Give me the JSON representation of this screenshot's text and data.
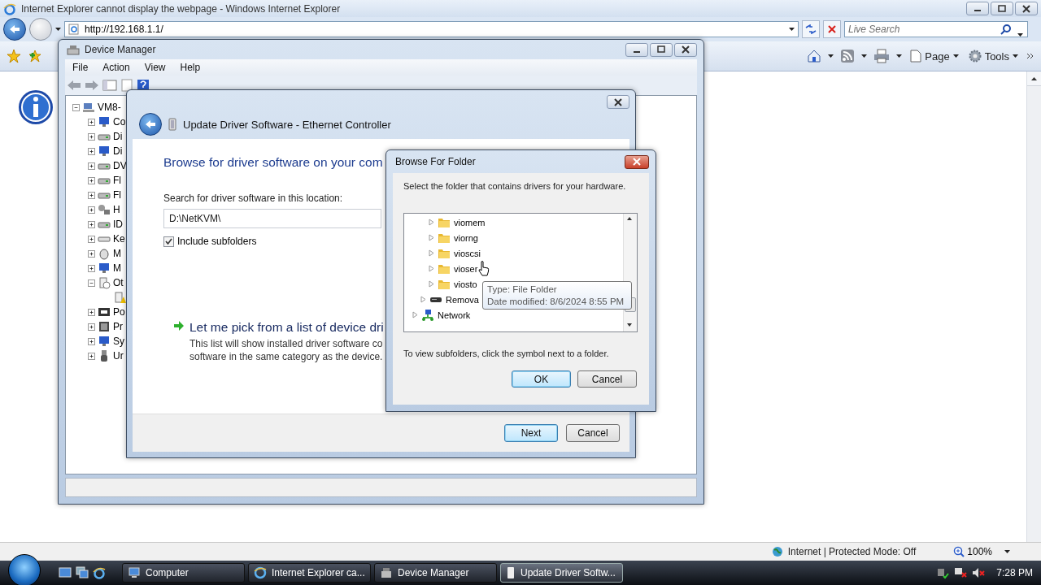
{
  "browser": {
    "title": "Internet Explorer cannot display the webpage - Windows Internet Explorer",
    "address": "http://192.168.1.1/",
    "search": {
      "placeholder": "Live Search"
    },
    "commands": [
      {
        "label": "Page",
        "kind": "page"
      },
      {
        "label": "Tools",
        "kind": "tools"
      }
    ],
    "status": "Internet | Protected Mode: Off",
    "zoom": "100%"
  },
  "device_manager": {
    "title": "Device Manager",
    "menu": [
      "File",
      "Action",
      "View",
      "Help"
    ],
    "tree": {
      "label": "VM8-",
      "expanded": true,
      "kind": "computer",
      "children": [
        {
          "label": "Co",
          "expanded": false,
          "kind": "monitor"
        },
        {
          "label": "Di",
          "expanded": false,
          "kind": "drive"
        },
        {
          "label": "Di",
          "expanded": false,
          "kind": "monitor"
        },
        {
          "label": "DV",
          "expanded": false,
          "kind": "drive"
        },
        {
          "label": "Fl",
          "expanded": false,
          "kind": "drive"
        },
        {
          "label": "Fl",
          "expanded": false,
          "kind": "drive"
        },
        {
          "label": "H",
          "expanded": false,
          "kind": "hid"
        },
        {
          "label": "ID",
          "expanded": false,
          "kind": "drive"
        },
        {
          "label": "Ke",
          "expanded": false,
          "kind": "keyboard"
        },
        {
          "label": "M",
          "expanded": false,
          "kind": "mouse"
        },
        {
          "label": "M",
          "expanded": false,
          "kind": "monitor"
        },
        {
          "label": "Ot",
          "expanded": true,
          "kind": "unknown",
          "children": [
            {
              "kind": "warning"
            }
          ]
        },
        {
          "label": "Po",
          "expanded": false,
          "kind": "port"
        },
        {
          "label": "Pr",
          "expanded": false,
          "kind": "chip"
        },
        {
          "label": "Sy",
          "expanded": false,
          "kind": "monitor"
        },
        {
          "label": "Ur",
          "expanded": false,
          "kind": "usb"
        }
      ]
    }
  },
  "update_driver": {
    "title": "Update Driver Software - Ethernet Controller",
    "heading": "Browse for driver software on your com",
    "location_label": "Search for driver software in this location:",
    "location": "D:\\NetKVM\\",
    "include_subfolders": {
      "label": "Include subfolders",
      "checked": true
    },
    "option": {
      "title": "Let me pick from a list of device dri",
      "description": [
        "This list will show installed driver software co",
        "software in the same category as the device."
      ]
    },
    "buttons": [
      {
        "label": "Next",
        "default": true
      },
      {
        "label": "Cancel",
        "default": false
      }
    ]
  },
  "browse_folder": {
    "title": "Browse For Folder",
    "instruction": "Select the folder that contains drivers for your hardware.",
    "tree": [
      {
        "children": [
          {
            "children": [
              {
                "label": "viomem",
                "kind": "folder"
              },
              {
                "label": "viorng",
                "kind": "folder"
              },
              {
                "label": "vioscsi",
                "kind": "folder"
              },
              {
                "label": "vioser",
                "kind": "folder"
              },
              {
                "label": "viosto",
                "kind": "folder"
              }
            ]
          },
          {
            "label": "Remova",
            "kind": "drive"
          }
        ]
      },
      {
        "label": "Network",
        "kind": "network"
      }
    ],
    "hint": "To view subfolders, click the symbol next to a folder.",
    "buttons": [
      {
        "label": "OK",
        "default": true
      },
      {
        "label": "Cancel",
        "default": false
      }
    ],
    "tooltip": [
      "Type: File Folder",
      "Date modified: 8/6/2024 8:55 PM"
    ]
  },
  "taskbar": {
    "items": [
      {
        "label": "Computer",
        "kind": "computer",
        "selected": false
      },
      {
        "label": "Internet Explorer ca...",
        "kind": "ie",
        "selected": false
      },
      {
        "label": "Device Manager",
        "kind": "devmgr",
        "selected": false
      },
      {
        "label": "Update Driver Softw...",
        "kind": "driver",
        "selected": true
      }
    ],
    "clock": "7:28 PM"
  }
}
